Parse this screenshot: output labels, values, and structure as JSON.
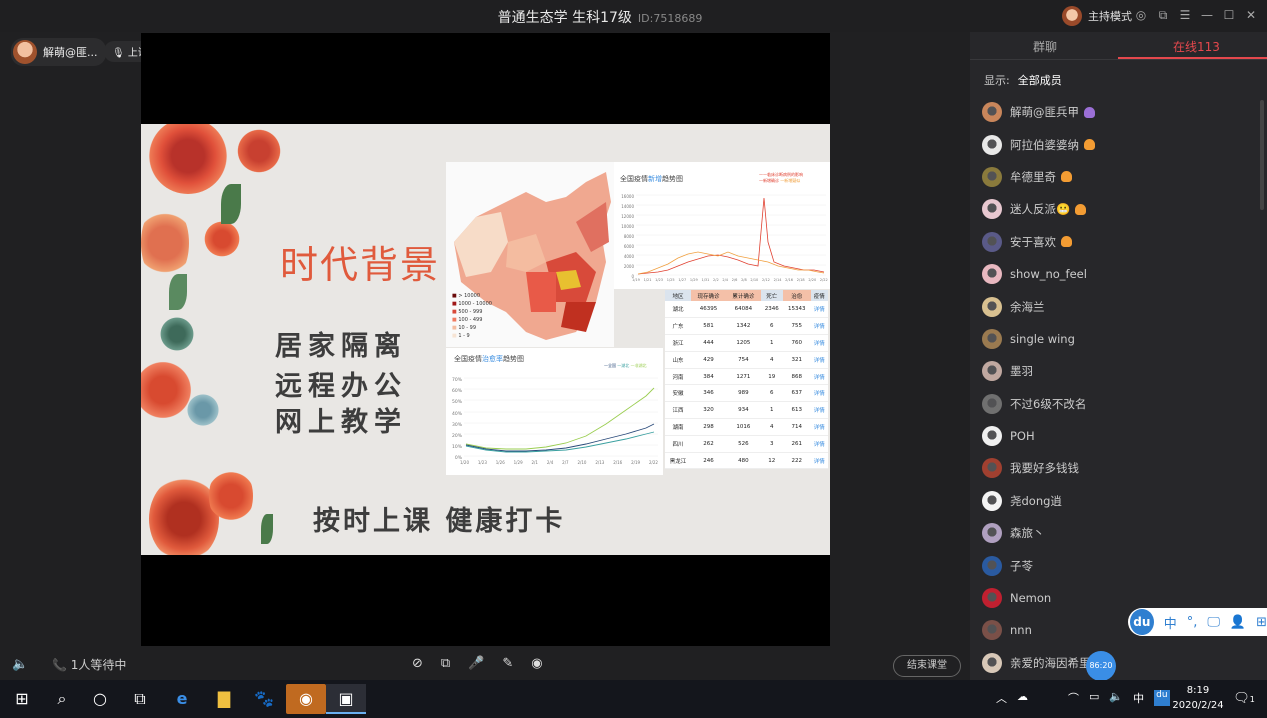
{
  "window": {
    "title": "普通生态学 生科17级",
    "room_id": "ID:7518689",
    "host_mode_label": "主持模式",
    "controls": [
      "◎",
      "⧉",
      "☰",
      "—",
      "☐",
      "✕"
    ]
  },
  "teacher": {
    "name": "解萌@匪...",
    "status": "上课中"
  },
  "slide": {
    "title": "时代背景",
    "lines": [
      "居家隔离",
      "远程办公",
      "网上教学"
    ],
    "bottom": "按时上课 健康打卡",
    "map_legend": [
      "> 10000",
      "1000 - 10000",
      "500 - 999",
      "100 - 499",
      "10 - 99",
      "1 - 9"
    ],
    "chart1": {
      "prefix": "全国疫情",
      "highlight": "新增",
      "suffix": "趋势图",
      "legend": [
        "——临床诊断病例的影响",
        "—新增确诊",
        "—新增疑似"
      ],
      "yticks": [
        "16000",
        "14000",
        "12000",
        "10000",
        "8000",
        "6000",
        "4000",
        "2000",
        "0"
      ],
      "xticks": [
        "1/19",
        "1/21",
        "1/23",
        "1/25",
        "1/27",
        "1/29",
        "1/31",
        "2/2",
        "2/4",
        "2/6",
        "2/8",
        "2/10",
        "2/12",
        "2/14",
        "2/16",
        "2/18",
        "2/20",
        "2/22"
      ]
    },
    "chart2": {
      "prefix": "全国疫情",
      "highlight": "治愈率",
      "suffix": "趋势图",
      "legend": [
        "—全国",
        "—湖北",
        "—非湖北"
      ],
      "yticks": [
        "70%",
        "60%",
        "50%",
        "40%",
        "30%",
        "20%",
        "10%",
        "0%"
      ],
      "xticks": [
        "1/20",
        "1/23",
        "1/26",
        "1/29",
        "2/1",
        "2/4",
        "2/7",
        "2/10",
        "2/13",
        "2/16",
        "2/19",
        "2/22"
      ]
    },
    "table": {
      "headers": [
        "地区",
        "现存确诊",
        "累计确诊",
        "死亡",
        "治愈",
        "疫情"
      ],
      "rows": [
        [
          "湖北",
          "46395",
          "64084",
          "2346",
          "15343",
          "详情"
        ],
        [
          "广东",
          "581",
          "1342",
          "6",
          "755",
          "详情"
        ],
        [
          "浙江",
          "444",
          "1205",
          "1",
          "760",
          "详情"
        ],
        [
          "山东",
          "429",
          "754",
          "4",
          "321",
          "详情"
        ],
        [
          "河南",
          "384",
          "1271",
          "19",
          "868",
          "详情"
        ],
        [
          "安徽",
          "346",
          "989",
          "6",
          "637",
          "详情"
        ],
        [
          "江西",
          "320",
          "934",
          "1",
          "613",
          "详情"
        ],
        [
          "湖南",
          "298",
          "1016",
          "4",
          "714",
          "详情"
        ],
        [
          "四川",
          "262",
          "526",
          "3",
          "261",
          "详情"
        ],
        [
          "黑龙江",
          "246",
          "480",
          "12",
          "222",
          "详情"
        ]
      ]
    }
  },
  "bottom": {
    "volume_icon": "🔈",
    "waiting": "1人等待中",
    "end_button": "结束课堂"
  },
  "panel": {
    "tab_group": "群聊",
    "tab_online": "在线113",
    "show_label": "显示:",
    "show_value": "全部成员",
    "members": [
      {
        "name": "解萌@匪兵甲",
        "color": "#c9865b",
        "badge": "#9b6fd6"
      },
      {
        "name": "阿拉伯婆婆纳",
        "color": "#e8e8e8",
        "badge": "#f39c33"
      },
      {
        "name": "牟德里奇",
        "color": "#8a7a3c",
        "badge": "#f39c33"
      },
      {
        "name": "迷人反派😬",
        "color": "#e8c8d0",
        "badge": "#f39c33"
      },
      {
        "name": "安于喜欢",
        "color": "#5a5a88",
        "badge": "#f39c33"
      },
      {
        "name": "show_no_feel",
        "color": "#e8b8c0",
        "badge": ""
      },
      {
        "name": "余海兰",
        "color": "#d8c090",
        "badge": ""
      },
      {
        "name": "single wing",
        "color": "#9a7a50",
        "badge": ""
      },
      {
        "name": "墨羽",
        "color": "#c0a8a0",
        "badge": ""
      },
      {
        "name": "不过6级不改名",
        "color": "#707070",
        "badge": ""
      },
      {
        "name": "POH",
        "color": "#f0f0f0",
        "badge": ""
      },
      {
        "name": "我要好多钱钱",
        "color": "#a04030",
        "badge": ""
      },
      {
        "name": "尧dong逍",
        "color": "#f4f4f4",
        "badge": ""
      },
      {
        "name": "森旅丶",
        "color": "#b0a0c0",
        "badge": ""
      },
      {
        "name": "子苓",
        "color": "#2a5aa0",
        "badge": ""
      },
      {
        "name": "Nemon",
        "color": "#c02030",
        "badge": ""
      },
      {
        "name": "nnn",
        "color": "#7a5048",
        "badge": ""
      },
      {
        "name": "亲爱的海因希里",
        "color": "#d8c8b8",
        "badge": ""
      }
    ]
  },
  "ime": {
    "logo": "du",
    "mode": "中",
    "items": [
      "°,",
      "🖵",
      "👤",
      "⊞"
    ]
  },
  "timer": "86:20",
  "taskbar": {
    "time": "8:19",
    "date": "2020/2/24",
    "tray_lang": "中",
    "tray_du": "du",
    "notif_count": "1"
  }
}
